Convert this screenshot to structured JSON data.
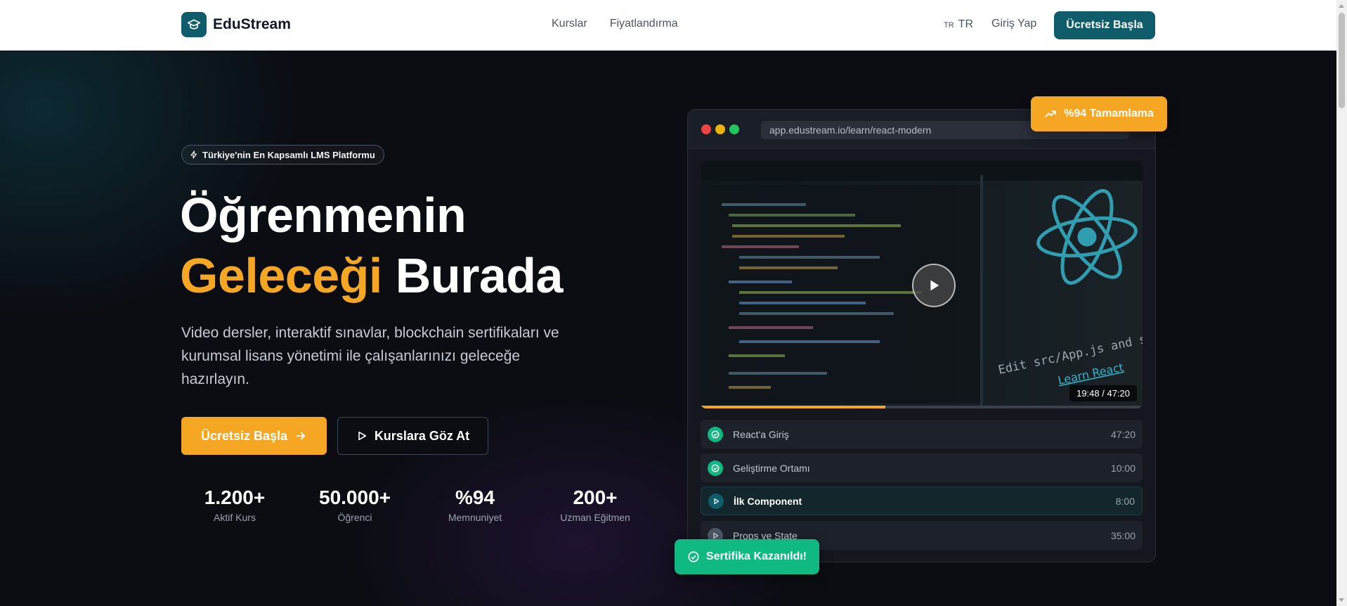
{
  "brand": {
    "name": "EduStream",
    "logo_icon": "graduation-cap-icon",
    "color": "#0f5c6b"
  },
  "nav": {
    "items": [
      "Kurslar",
      "Fiyatlandırma"
    ]
  },
  "header": {
    "lang_flag": "TR",
    "lang_code": "TR",
    "login_label": "Giriş Yap",
    "cta_label": "Ücretsiz Başla"
  },
  "hero": {
    "badge": "Türkiye'nin En Kapsamlı LMS Platformu",
    "title_line1": "Öğrenmenin",
    "title_accent": "Geleceği",
    "title_rest": " Burada",
    "subtitle": "Video dersler, interaktif sınavlar, blockchain sertifikaları ve kurumsal lisans yönetimi ile çalışanlarınızı geleceğe hazırlayın.",
    "primary_cta": "Ücretsiz Başla",
    "secondary_cta": "Kurslara Göz At",
    "accent_color": "#f5a623"
  },
  "stats": [
    {
      "value": "1.200+",
      "label": "Aktif Kurs"
    },
    {
      "value": "50.000+",
      "label": "Öğrenci"
    },
    {
      "value": "%94",
      "label": "Memnuniyet"
    },
    {
      "value": "200+",
      "label": "Uzman Eğitmen"
    }
  ],
  "preview": {
    "url": "app.edustream.io/learn/react-modern",
    "timecode": "19:48 / 47:20",
    "progress_fraction": 0.418,
    "video_overlay": {
      "line1": "Edit src/App.js and save to rel",
      "line2": "Learn React"
    },
    "lessons": [
      {
        "title": "React'a Giriş",
        "duration": "47:20",
        "status": "completed"
      },
      {
        "title": "Geliştirme Ortamı",
        "duration": "10:00",
        "status": "completed"
      },
      {
        "title": "İlk Component",
        "duration": "8:00",
        "status": "active"
      },
      {
        "title": "Props ve State",
        "duration": "35:00",
        "status": "locked"
      }
    ]
  },
  "floating": {
    "completion": "%94 Tamamlama",
    "certificate": "Sertifika Kazanıldı!"
  }
}
